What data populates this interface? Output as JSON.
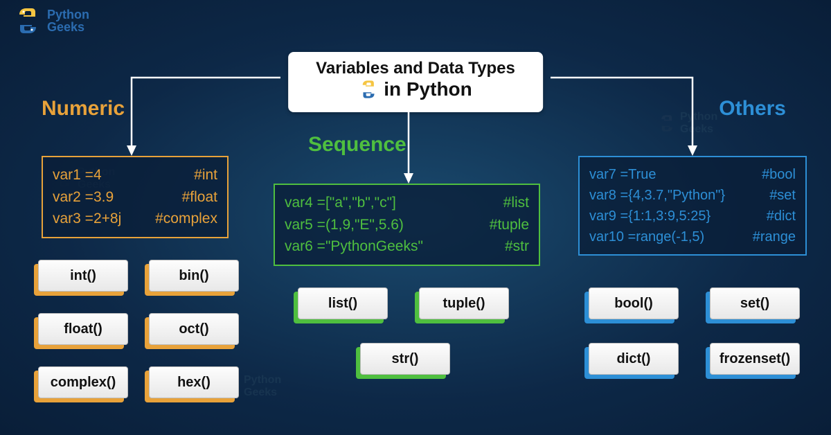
{
  "brand": {
    "line1": "Python",
    "line2": "Geeks"
  },
  "title": {
    "line1": "Variables and Data Types",
    "line2": "in Python"
  },
  "categories": {
    "numeric": {
      "label": "Numeric",
      "code": [
        {
          "lhs": "var1 =4",
          "cmt": "#int"
        },
        {
          "lhs": "var2 =3.9",
          "cmt": "#float"
        },
        {
          "lhs": "var3 =2+8j",
          "cmt": "#complex"
        }
      ],
      "fns": [
        "int()",
        "bin()",
        "float()",
        "oct()",
        "complex()",
        "hex()"
      ]
    },
    "sequence": {
      "label": "Sequence",
      "code": [
        {
          "lhs": "var4 =[\"a\",\"b\",\"c\"]",
          "cmt": "#list"
        },
        {
          "lhs": "var5 =(1,9,\"E\",5.6)",
          "cmt": "#tuple"
        },
        {
          "lhs": "var6 =\"PythonGeeks\"",
          "cmt": "#str"
        }
      ],
      "fns": [
        "list()",
        "tuple()",
        "str()"
      ]
    },
    "others": {
      "label": "Others",
      "code": [
        {
          "lhs": "var7 =True",
          "cmt": "#bool"
        },
        {
          "lhs": "var8 ={4,3.7,\"Python\"}",
          "cmt": "#set"
        },
        {
          "lhs": "var9 ={1:1,3:9,5:25}",
          "cmt": "#dict"
        },
        {
          "lhs": "var10 =range(-1,5)",
          "cmt": "#range"
        }
      ],
      "fns": [
        "bool()",
        "set()",
        "dict()",
        "frozenset()"
      ]
    }
  }
}
